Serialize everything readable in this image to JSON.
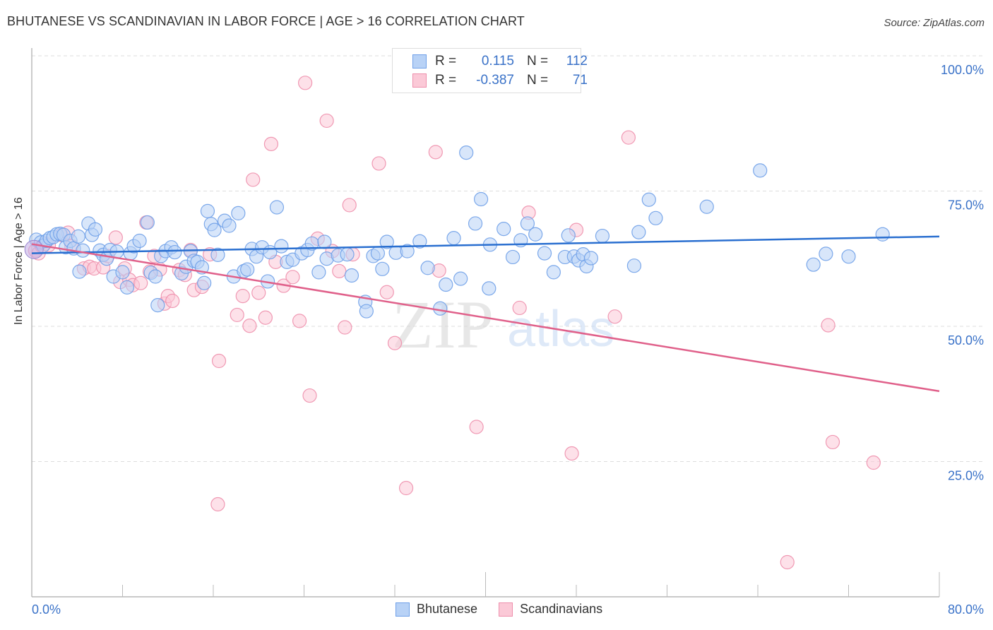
{
  "title": "BHUTANESE VS SCANDINAVIAN IN LABOR FORCE | AGE > 16 CORRELATION CHART",
  "source": "Source: ZipAtlas.com",
  "legend_top": [
    {
      "r_label": "R =",
      "r_value": "0.115",
      "n_label": "N =",
      "n_value": "112",
      "color": "#6fa0e8",
      "fill": "#b8d2f6"
    },
    {
      "r_label": "R =",
      "r_value": "-0.387",
      "n_label": "N =",
      "n_value": "71",
      "color": "#ee8fac",
      "fill": "#fbc9d7"
    }
  ],
  "legend_bottom": [
    {
      "label": "Bhutanese",
      "color": "#6fa0e8",
      "fill": "#b8d2f6"
    },
    {
      "label": "Scandinavians",
      "color": "#ee8fac",
      "fill": "#fbc9d7"
    }
  ],
  "watermark": {
    "zip": "ZIP",
    "atlas": "atlas"
  },
  "chart_data": {
    "type": "scatter",
    "title": "BHUTANESE VS SCANDINAVIAN IN LABOR FORCE | AGE > 16 CORRELATION CHART",
    "xlabel": "",
    "ylabel": "In Labor Force | Age > 16",
    "xlim": [
      0,
      80
    ],
    "ylim": [
      0,
      102
    ],
    "x_tick_labels": [
      "0.0%",
      "80.0%"
    ],
    "x_minor_ticks": [
      8,
      16,
      24,
      32,
      40,
      48,
      56,
      64,
      72,
      80
    ],
    "y_ticks": [
      25,
      50,
      75,
      100
    ],
    "y_tick_labels": [
      "25.0%",
      "50.0%",
      "75.0%",
      "100.0%"
    ],
    "grid": true,
    "legend_position": "top-center",
    "series": [
      {
        "name": "Bhutanese",
        "color": "#6fa0e8",
        "fill": "#b8d2f6",
        "trend": {
          "x": [
            0,
            80
          ],
          "y": [
            63.5,
            66.6
          ],
          "color": "#2a6fd0"
        },
        "points": [
          [
            0.4,
            66.0
          ],
          [
            0.8,
            65.5
          ],
          [
            1.0,
            64.9
          ],
          [
            1.3,
            65.8
          ],
          [
            1.6,
            66.3
          ],
          [
            1.9,
            66.5
          ],
          [
            2.2,
            67.0
          ],
          [
            2.5,
            67.1
          ],
          [
            2.8,
            66.9
          ],
          [
            3.0,
            64.6
          ],
          [
            3.4,
            65.8
          ],
          [
            3.7,
            64.4
          ],
          [
            4.1,
            66.6
          ],
          [
            4.2,
            60.1
          ],
          [
            4.5,
            64.0
          ],
          [
            5.0,
            69.0
          ],
          [
            5.3,
            66.9
          ],
          [
            5.6,
            67.9
          ],
          [
            6.0,
            64.0
          ],
          [
            6.3,
            63.2
          ],
          [
            6.6,
            62.5
          ],
          [
            6.9,
            64.1
          ],
          [
            7.2,
            59.2
          ],
          [
            7.5,
            63.8
          ],
          [
            8.0,
            60.0
          ],
          [
            8.4,
            57.2
          ],
          [
            8.7,
            63.5
          ],
          [
            9.0,
            64.8
          ],
          [
            9.5,
            65.8
          ],
          [
            10.2,
            69.2
          ],
          [
            10.5,
            59.9
          ],
          [
            10.9,
            59.2
          ],
          [
            11.1,
            53.9
          ],
          [
            11.4,
            63.0
          ],
          [
            11.8,
            63.9
          ],
          [
            12.3,
            64.6
          ],
          [
            12.6,
            63.7
          ],
          [
            13.2,
            59.8
          ],
          [
            13.6,
            61.0
          ],
          [
            14.0,
            63.9
          ],
          [
            14.3,
            62.1
          ],
          [
            14.6,
            61.9
          ],
          [
            15.0,
            60.9
          ],
          [
            15.2,
            58.0
          ],
          [
            15.5,
            71.3
          ],
          [
            15.8,
            68.9
          ],
          [
            16.1,
            67.8
          ],
          [
            16.4,
            63.2
          ],
          [
            17.0,
            69.5
          ],
          [
            17.4,
            68.6
          ],
          [
            17.8,
            59.2
          ],
          [
            18.2,
            70.9
          ],
          [
            18.7,
            60.2
          ],
          [
            19.0,
            60.5
          ],
          [
            19.4,
            64.3
          ],
          [
            19.8,
            62.9
          ],
          [
            20.3,
            64.6
          ],
          [
            20.8,
            58.3
          ],
          [
            21.0,
            63.7
          ],
          [
            21.6,
            72.0
          ],
          [
            22.0,
            64.8
          ],
          [
            22.5,
            61.9
          ],
          [
            23.0,
            62.3
          ],
          [
            23.8,
            63.5
          ],
          [
            24.3,
            64.1
          ],
          [
            24.7,
            65.3
          ],
          [
            25.3,
            60.0
          ],
          [
            25.8,
            65.6
          ],
          [
            26.0,
            62.5
          ],
          [
            27.0,
            63.1
          ],
          [
            27.8,
            63.3
          ],
          [
            28.2,
            59.4
          ],
          [
            29.4,
            54.5
          ],
          [
            29.5,
            52.8
          ],
          [
            30.1,
            63.0
          ],
          [
            30.5,
            63.5
          ],
          [
            30.9,
            60.6
          ],
          [
            31.3,
            65.6
          ],
          [
            32.1,
            63.6
          ],
          [
            33.1,
            63.9
          ],
          [
            34.2,
            65.7
          ],
          [
            34.9,
            60.8
          ],
          [
            36.0,
            53.3
          ],
          [
            36.5,
            57.7
          ],
          [
            37.2,
            66.3
          ],
          [
            37.8,
            58.8
          ],
          [
            38.3,
            82.1
          ],
          [
            39.1,
            69.0
          ],
          [
            39.6,
            73.5
          ],
          [
            40.3,
            57.0
          ],
          [
            40.4,
            65.1
          ],
          [
            41.6,
            68.0
          ],
          [
            42.4,
            62.8
          ],
          [
            43.1,
            65.9
          ],
          [
            43.7,
            69.0
          ],
          [
            44.4,
            67.0
          ],
          [
            45.2,
            63.5
          ],
          [
            46.0,
            60.0
          ],
          [
            47.0,
            62.8
          ],
          [
            47.3,
            66.8
          ],
          [
            47.8,
            62.9
          ],
          [
            48.2,
            62.2
          ],
          [
            48.6,
            63.3
          ],
          [
            48.9,
            61.1
          ],
          [
            49.3,
            62.6
          ],
          [
            50.3,
            66.7
          ],
          [
            53.1,
            61.2
          ],
          [
            53.5,
            67.4
          ],
          [
            54.4,
            73.4
          ],
          [
            55.0,
            70.0
          ],
          [
            59.5,
            72.1
          ],
          [
            64.2,
            78.8
          ],
          [
            68.9,
            61.4
          ],
          [
            70.0,
            63.4
          ],
          [
            72.0,
            62.9
          ],
          [
            75.0,
            67.0
          ]
        ]
      },
      {
        "name": "Scandinavians",
        "color": "#ee8fac",
        "fill": "#fbc9d7",
        "trend": {
          "x": [
            0,
            80
          ],
          "y": [
            65.2,
            38.0
          ],
          "color": "#e0608a"
        },
        "points": [
          [
            0.3,
            64.0
          ],
          [
            0.6,
            63.5
          ],
          [
            0.9,
            64.8
          ],
          [
            1.2,
            65.3
          ],
          [
            1.5,
            65.0
          ],
          [
            2.6,
            66.9
          ],
          [
            3.2,
            67.3
          ],
          [
            3.5,
            64.8
          ],
          [
            4.6,
            60.7
          ],
          [
            5.1,
            61.0
          ],
          [
            5.5,
            60.7
          ],
          [
            6.3,
            60.9
          ],
          [
            6.7,
            63.0
          ],
          [
            7.4,
            66.4
          ],
          [
            7.8,
            58.2
          ],
          [
            8.2,
            60.7
          ],
          [
            8.6,
            58.6
          ],
          [
            8.9,
            57.6
          ],
          [
            9.6,
            58.0
          ],
          [
            10.1,
            69.2
          ],
          [
            10.4,
            60.1
          ],
          [
            10.8,
            63.0
          ],
          [
            11.3,
            60.5
          ],
          [
            11.7,
            54.2
          ],
          [
            12.0,
            55.6
          ],
          [
            12.4,
            54.7
          ],
          [
            13.0,
            60.4
          ],
          [
            13.5,
            59.5
          ],
          [
            14.0,
            64.1
          ],
          [
            14.3,
            56.7
          ],
          [
            15.0,
            57.3
          ],
          [
            15.7,
            63.3
          ],
          [
            16.5,
            43.6
          ],
          [
            16.4,
            17.1
          ],
          [
            18.1,
            52.1
          ],
          [
            18.6,
            55.6
          ],
          [
            19.2,
            50.1
          ],
          [
            19.5,
            77.1
          ],
          [
            20.0,
            56.2
          ],
          [
            20.6,
            51.6
          ],
          [
            21.1,
            83.7
          ],
          [
            21.5,
            61.9
          ],
          [
            22.2,
            57.5
          ],
          [
            23.0,
            59.1
          ],
          [
            23.6,
            51.0
          ],
          [
            24.1,
            95.0
          ],
          [
            24.5,
            37.2
          ],
          [
            25.2,
            66.2
          ],
          [
            26.0,
            88.0
          ],
          [
            26.5,
            63.9
          ],
          [
            27.1,
            60.2
          ],
          [
            27.6,
            49.8
          ],
          [
            28.0,
            72.4
          ],
          [
            28.3,
            63.3
          ],
          [
            30.6,
            80.1
          ],
          [
            31.3,
            56.3
          ],
          [
            32.0,
            46.9
          ],
          [
            33.0,
            20.1
          ],
          [
            35.6,
            82.2
          ],
          [
            35.9,
            60.3
          ],
          [
            39.2,
            31.4
          ],
          [
            43.0,
            53.4
          ],
          [
            43.8,
            71.0
          ],
          [
            47.6,
            26.5
          ],
          [
            48.0,
            67.8
          ],
          [
            51.4,
            51.8
          ],
          [
            52.6,
            84.9
          ],
          [
            70.2,
            50.2
          ],
          [
            70.6,
            28.6
          ],
          [
            74.2,
            24.8
          ],
          [
            66.6,
            6.4
          ]
        ]
      }
    ]
  }
}
